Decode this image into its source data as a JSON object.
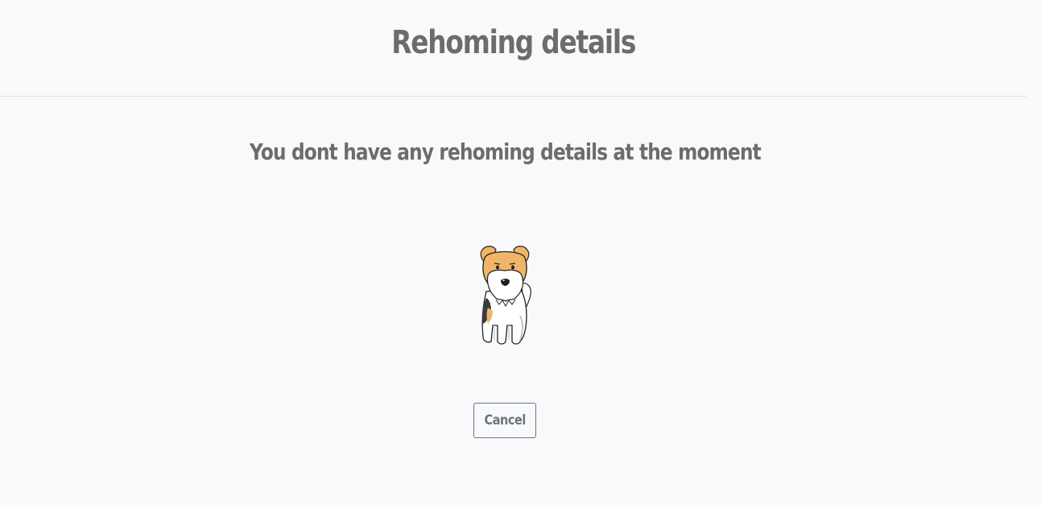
{
  "header": {
    "title": "Rehoming details"
  },
  "main": {
    "empty_message": "You dont have any rehoming details at the moment",
    "illustration_icon": "terrier-dog-icon",
    "cancel_label": "Cancel"
  },
  "colors": {
    "background": "#f8f9fb",
    "text": "#6c6c6c",
    "button_border": "#6c757d",
    "dog_tan": "#f1b56a"
  }
}
